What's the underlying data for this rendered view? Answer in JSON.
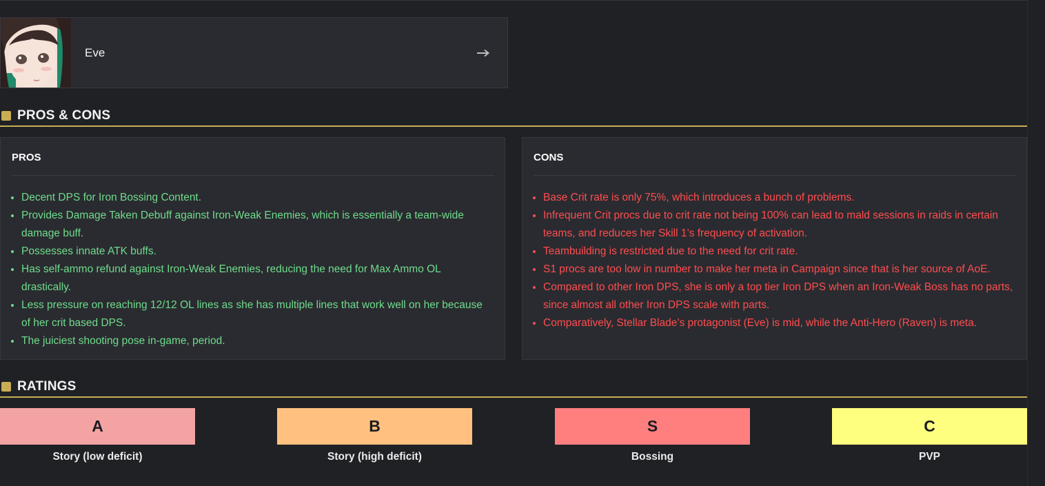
{
  "character": {
    "name": "Eve",
    "arrow_icon": "arrow-right-icon"
  },
  "pros_cons": {
    "heading": "PROS & CONS",
    "pros": {
      "title": "PROS",
      "color": "#6fdc8c",
      "items": [
        "Decent DPS for Iron Bossing Content.",
        "Provides Damage Taken Debuff against Iron-Weak Enemies, which is essentially a team-wide damage buff.",
        "Possesses innate ATK buffs.",
        "Has self-ammo refund against Iron-Weak Enemies, reducing the need for Max Ammo OL drastically.",
        "Less pressure on reaching 12/12 OL lines as she has multiple lines that work well on her because of her crit based DPS.",
        "The juiciest shooting pose in-game, period."
      ]
    },
    "cons": {
      "title": "CONS",
      "color": "#ff4d4f",
      "items": [
        "Base Crit rate is only 75%, which introduces a bunch of problems.",
        "Infrequent Crit procs due to crit rate not being 100% can lead to mald sessions in raids in certain teams, and reduces her Skill 1’s frequency of activation.",
        "Teambuilding is restricted due to the need for crit rate.",
        "S1 procs are too low in number to make her meta in Campaign since that is her source of AoE.",
        "Compared to other Iron DPS, she is only a top tier Iron DPS when an Iron-Weak Boss has no parts, since almost all other Iron DPS scale with parts.",
        "Comparatively, Stellar Blade’s protagonist (Eve) is mid, while the Anti-Hero (Raven) is meta."
      ]
    }
  },
  "ratings": {
    "heading": "RATINGS",
    "items": [
      {
        "grade": "A",
        "label": "Story (low deficit)",
        "color": "#f4a3a3"
      },
      {
        "grade": "B",
        "label": "Story (high deficit)",
        "color": "#ffc080"
      },
      {
        "grade": "S",
        "label": "Bossing",
        "color": "#ff7f7f"
      },
      {
        "grade": "C",
        "label": "PVP",
        "color": "#ffff7f"
      }
    ]
  },
  "accent_color": "#c9ae54"
}
